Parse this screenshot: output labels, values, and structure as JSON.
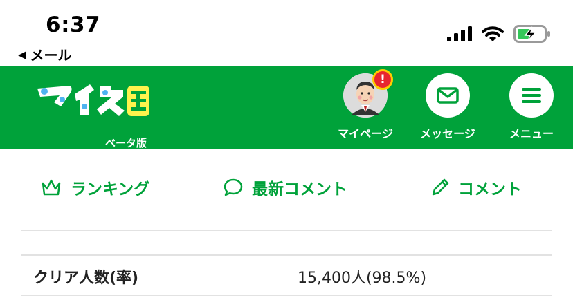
{
  "status_bar": {
    "time": "6:37",
    "back_app": "メール",
    "back_caret": "◀",
    "icons": [
      "signal-icon",
      "wifi-icon",
      "battery-charging-icon"
    ]
  },
  "header": {
    "logo_text": "マイネ王",
    "logo_sub": "ベータ版",
    "nav": [
      {
        "label": "マイページ",
        "icon": "avatar-icon",
        "badge": "!"
      },
      {
        "label": "メッセージ",
        "icon": "envelope-icon"
      },
      {
        "label": "メニュー",
        "icon": "hamburger-icon"
      }
    ],
    "colors": {
      "brand": "#00a23a",
      "badge": "#e8262f",
      "badge_ring": "#ffcc00"
    }
  },
  "tabs": [
    {
      "label": "ランキング",
      "icon": "crown-icon"
    },
    {
      "label": "最新コメント",
      "icon": "speech-bubble-icon"
    },
    {
      "label": "コメント",
      "icon": "pencil-icon"
    }
  ],
  "stats": {
    "label": "クリア人数(率)",
    "value": "15,400人(98.5%)"
  }
}
